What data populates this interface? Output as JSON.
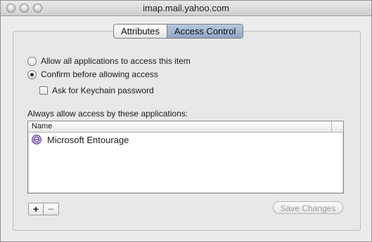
{
  "window": {
    "title": "imap.mail.yahoo.com"
  },
  "tabs": [
    {
      "label": "Attributes",
      "active": false
    },
    {
      "label": "Access Control",
      "active": true
    }
  ],
  "access": {
    "allow_all_label": "Allow all applications to access this item",
    "confirm_label": "Confirm before allowing access",
    "ask_keychain_label": "Ask for Keychain password",
    "selected": "confirm",
    "ask_keychain_checked": false
  },
  "applications": {
    "section_label": "Always allow access by these applications:",
    "column_header": "Name",
    "rows": [
      {
        "name": "Microsoft Entourage",
        "icon": "entourage-icon"
      }
    ]
  },
  "controls": {
    "add_symbol": "+",
    "remove_symbol": "−",
    "save_label": "Save Changes"
  }
}
